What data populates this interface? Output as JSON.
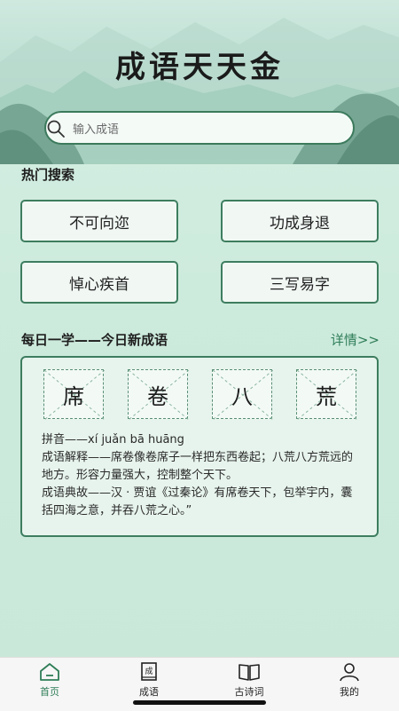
{
  "app": {
    "title": "成语天天金"
  },
  "search": {
    "placeholder": "输入成语"
  },
  "hot": {
    "title": "热门搜索",
    "items": [
      "不可向迩",
      "功成身退",
      "悼心疾首",
      "三写易字"
    ]
  },
  "daily": {
    "title": "每日一学——今日新成语",
    "more": "详情>>",
    "chars": [
      "席",
      "卷",
      "八",
      "荒"
    ],
    "pinyin": "拼音——xí juǎn bā huāng",
    "meaning": "成语解释——席卷像卷席子一样把东西卷起；八荒八方荒远的地方。形容力量强大，控制整个天下。",
    "source": "成语典故——汉 · 贾谊《过秦论》有席卷天下，包举宇内，囊括四海之意，并吞八荒之心。”"
  },
  "tabs": [
    {
      "label": "首页",
      "icon": "home-icon",
      "active": true
    },
    {
      "label": "成语",
      "icon": "idiom-book-icon",
      "active": false
    },
    {
      "label": "古诗词",
      "icon": "open-book-icon",
      "active": false
    },
    {
      "label": "我的",
      "icon": "user-icon",
      "active": false
    }
  ],
  "colors": {
    "accent": "#3d7d5f",
    "active_tab": "#2e7d57",
    "background": "#cdebdd"
  }
}
